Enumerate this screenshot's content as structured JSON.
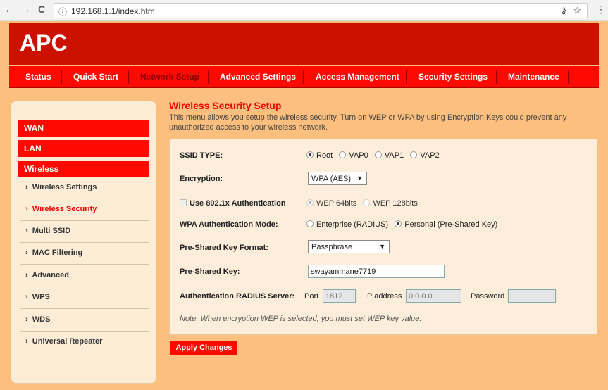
{
  "browser": {
    "url": "192.168.1.1/index.htm",
    "back_icon": "←",
    "forward_icon": "→",
    "reload_icon": "C",
    "info_icon": "ⓘ",
    "key_icon": "key",
    "star_icon": "☆",
    "menu_icon": "⋮"
  },
  "header": {
    "logo": "APC"
  },
  "nav": [
    {
      "label": "Status"
    },
    {
      "label": "Quick Start"
    },
    {
      "label": "Network Setup",
      "active": true
    },
    {
      "label": "Advanced Settings"
    },
    {
      "label": "Access Management"
    },
    {
      "label": "Security Settings"
    },
    {
      "label": "Maintenance"
    }
  ],
  "sidebar": {
    "sections": [
      "WAN",
      "LAN",
      "Wireless"
    ],
    "items": [
      {
        "label": "Wireless Settings"
      },
      {
        "label": "Wireless Security",
        "active": true
      },
      {
        "label": "Multi SSID"
      },
      {
        "label": "MAC Filtering"
      },
      {
        "label": "Advanced"
      },
      {
        "label": "WPS"
      },
      {
        "label": "WDS"
      },
      {
        "label": "Universal Repeater"
      }
    ]
  },
  "main": {
    "title": "Wireless Security Setup",
    "description": "This menu allows you setup the wireless security. Turn on WEP or WPA by using Encryption Keys could prevent any unauthorized access to your wireless network.",
    "ssid_type": {
      "label": "SSID TYPE:",
      "options": [
        "Root",
        "VAP0",
        "VAP1",
        "VAP2"
      ],
      "selected": "Root"
    },
    "encryption": {
      "label": "Encryption:",
      "value": "WPA (AES)"
    },
    "use_8021x": {
      "label": "Use 802.1x Authentication",
      "checked": false,
      "options": [
        "WEP 64bits",
        "WEP 128bits"
      ],
      "selected": "WEP 64bits"
    },
    "wpa_mode": {
      "label": "WPA Authentication Mode:",
      "options": [
        "Enterprise (RADIUS)",
        "Personal (Pre-Shared Key)"
      ],
      "selected": "Personal (Pre-Shared Key)"
    },
    "psk_format": {
      "label": "Pre-Shared Key Format:",
      "value": "Passphrase"
    },
    "psk": {
      "label": "Pre-Shared Key:",
      "value": "swayammane7719"
    },
    "radius": {
      "label": "Authentication RADIUS Server:",
      "port_label": "Port",
      "port": "1812",
      "ip_label": "IP address",
      "ip": "0.0.0.0",
      "password_label": "Password",
      "password": ""
    },
    "note": "Note: When encryption WEP is selected, you must set WEP key value.",
    "apply_label": "Apply Changes"
  },
  "colors": {
    "header": "#cc1100",
    "nav": "#ff0a00",
    "page": "#fdbf7e",
    "accent": "#e00000"
  }
}
